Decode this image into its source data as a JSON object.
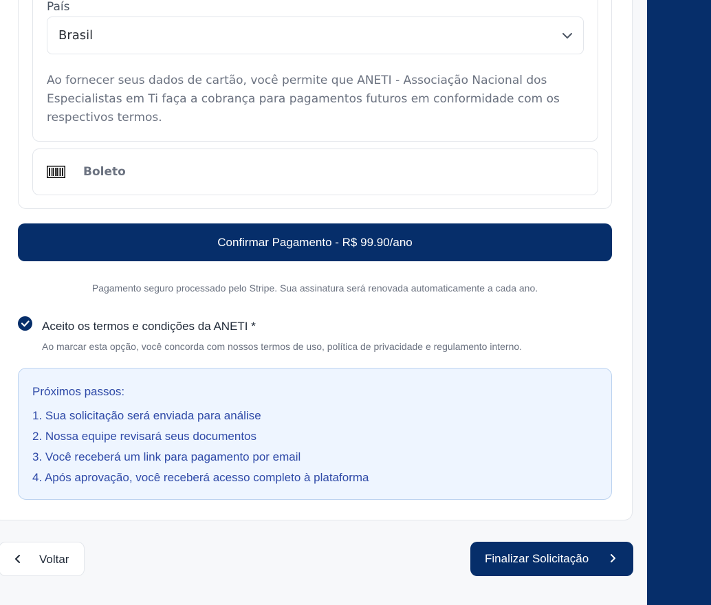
{
  "payment": {
    "country_label": "País",
    "country_value": "Brasil",
    "mandate_text": "Ao fornecer seus dados de cartão, você permite que ANETI - Associação Nacional dos Especialistas em Ti faça a cobrança para pagamentos futuros em conformidade com os respectivos termos.",
    "boleto_label": "Boleto"
  },
  "confirm_button": "Confirmar Pagamento - R$ 99.90/ano",
  "secure_note": "Pagamento seguro processado pelo Stripe. Sua assinatura será renovada automaticamente a cada ano.",
  "terms": {
    "checked": true,
    "label": "Aceito os termos e condições da ANETI *",
    "description": "Ao marcar esta opção, você concorda com nossos termos de uso, política de privacidade e regulamento interno."
  },
  "next_steps": {
    "title": "Próximos passos:",
    "items": [
      "1. Sua solicitação será enviada para análise",
      "2. Nossa equipe revisará seus documentos",
      "3. Você receberá um link para pagamento por email",
      "4. Após aprovação, você receberá acesso completo à plataforma"
    ]
  },
  "nav": {
    "back_label": "Voltar",
    "finish_label": "Finalizar Solicitação"
  },
  "colors": {
    "primary": "#062e6a",
    "info_bg": "#eef5ff",
    "info_text": "#2f4aa8"
  }
}
